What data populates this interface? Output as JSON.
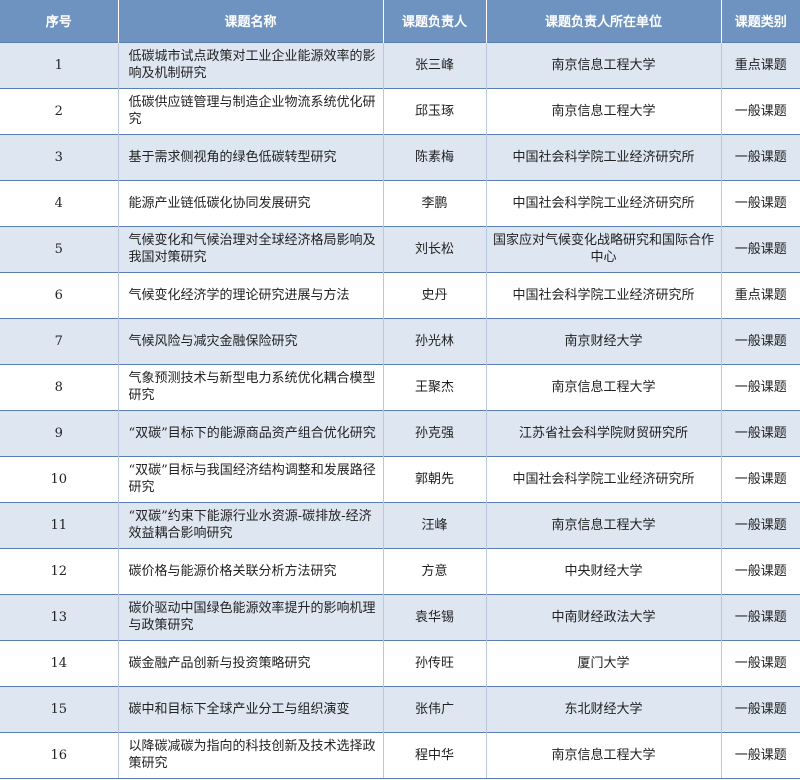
{
  "table": {
    "headers": [
      "序号",
      "课题名称",
      "课题负责人",
      "课题负责人所在单位",
      "课题类别"
    ],
    "rows": [
      {
        "no": "1",
        "title": "低碳城市试点政策对工业企业能源效率的影响及机制研究",
        "lead": "张三峰",
        "unit": "南京信息工程大学",
        "type": "重点课题"
      },
      {
        "no": "2",
        "title": "低碳供应链管理与制造企业物流系统优化研究",
        "lead": "邱玉琢",
        "unit": "南京信息工程大学",
        "type": "一般课题"
      },
      {
        "no": "3",
        "title": "基于需求侧视角的绿色低碳转型研究",
        "lead": "陈素梅",
        "unit": "中国社会科学院工业经济研究所",
        "type": "一般课题"
      },
      {
        "no": "4",
        "title": "能源产业链低碳化协同发展研究",
        "lead": "李鹏",
        "unit": "中国社会科学院工业经济研究所",
        "type": "一般课题"
      },
      {
        "no": "5",
        "title": "气候变化和气候治理对全球经济格局影响及我国对策研究",
        "lead": "刘长松",
        "unit": "国家应对气候变化战略研究和国际合作中心",
        "type": "一般课题"
      },
      {
        "no": "6",
        "title": "气候变化经济学的理论研究进展与方法",
        "lead": "史丹",
        "unit": "中国社会科学院工业经济研究所",
        "type": "重点课题"
      },
      {
        "no": "7",
        "title": "气候风险与减灾金融保险研究",
        "lead": "孙光林",
        "unit": "南京财经大学",
        "type": "一般课题"
      },
      {
        "no": "8",
        "title": "气象预测技术与新型电力系统优化耦合模型研究",
        "lead": "王聚杰",
        "unit": "南京信息工程大学",
        "type": "一般课题"
      },
      {
        "no": "9",
        "title": "“双碳”目标下的能源商品资产组合优化研究",
        "lead": "孙克强",
        "unit": "江苏省社会科学院财贸研究所",
        "type": "一般课题"
      },
      {
        "no": "10",
        "title": "“双碳”目标与我国经济结构调整和发展路径研究",
        "lead": "郭朝先",
        "unit": "中国社会科学院工业经济研究所",
        "type": "一般课题"
      },
      {
        "no": "11",
        "title": "“双碳”约束下能源行业水资源-碳排放-经济效益耦合影响研究",
        "lead": "汪峰",
        "unit": "南京信息工程大学",
        "type": "一般课题"
      },
      {
        "no": "12",
        "title": "碳价格与能源价格关联分析方法研究",
        "lead": "方意",
        "unit": "中央财经大学",
        "type": "一般课题"
      },
      {
        "no": "13",
        "title": "碳价驱动中国绿色能源效率提升的影响机理与政策研究",
        "lead": "袁华锡",
        "unit": "中南财经政法大学",
        "type": "一般课题"
      },
      {
        "no": "14",
        "title": "碳金融产品创新与投资策略研究",
        "lead": "孙传旺",
        "unit": "厦门大学",
        "type": "一般课题"
      },
      {
        "no": "15",
        "title": "碳中和目标下全球产业分工与组织演变",
        "lead": "张伟广",
        "unit": "东北财经大学",
        "type": "一般课题"
      },
      {
        "no": "16",
        "title": "以降碳减碳为指向的科技创新及技术选择政策研究",
        "lead": "程中华",
        "unit": "南京信息工程大学",
        "type": "一般课题"
      }
    ]
  }
}
